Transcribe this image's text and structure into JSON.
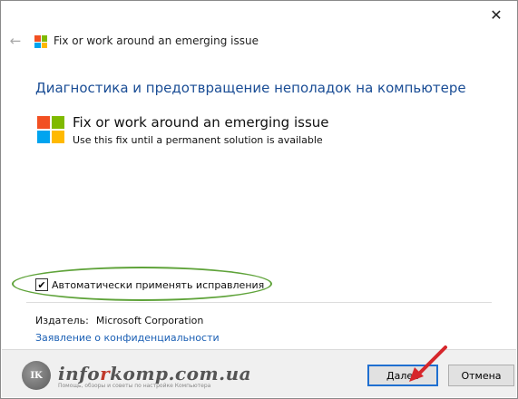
{
  "window": {
    "title": "Fix or work around an emerging issue",
    "close_glyph": "✕",
    "back_glyph": "←"
  },
  "main": {
    "heading": "Диагностика и предотвращение неполадок на компьютере",
    "item": {
      "title": "Fix or work around an emerging issue",
      "description": "Use this fix until a permanent solution is available"
    },
    "auto_apply": {
      "label": "Автоматически применять исправления",
      "checked": true,
      "check_glyph": "✔"
    },
    "publisher": {
      "label": "Издатель:",
      "name": "Microsoft Corporation"
    },
    "privacy_link": "Заявление о конфиденциальности"
  },
  "footer": {
    "watermark": {
      "logo_text": "IK",
      "title_pre": "info",
      "title_accent": "r",
      "title_post": "komp.com.ua",
      "subtitle": "Помощь, обзоры и советы по настройке Компьютера"
    },
    "next_label": "Далее",
    "cancel_label": "Отмена"
  },
  "colors": {
    "heading": "#1a4d95",
    "link": "#1a5fb4",
    "ms_red": "#f25022",
    "ms_green": "#7fba00",
    "ms_blue": "#00a4ef",
    "ms_yellow": "#ffb900",
    "highlight_ellipse": "#5fa33a",
    "annotation_arrow": "#d6262b"
  }
}
